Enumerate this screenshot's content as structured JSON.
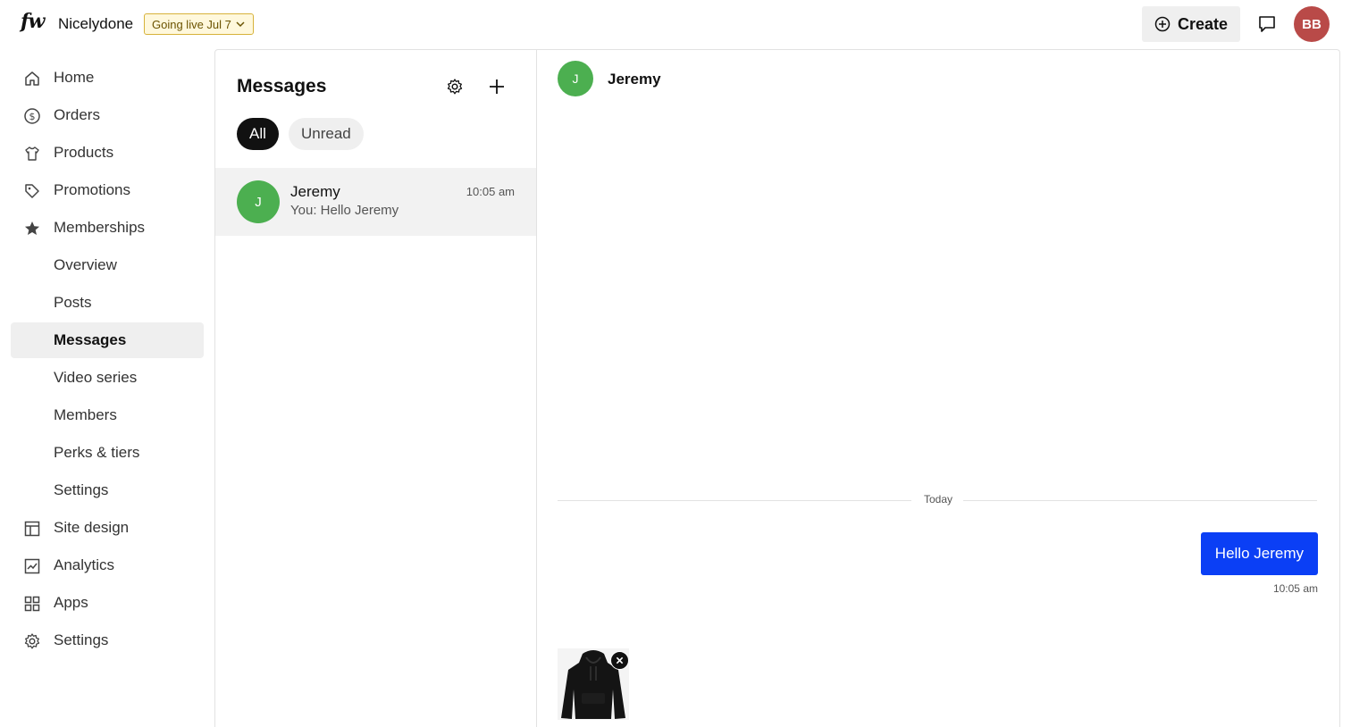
{
  "header": {
    "logo_text": "fw",
    "brand_name": "Nicelydone",
    "live_badge": "Going live Jul 7",
    "create_label": "Create",
    "user_initials": "BB"
  },
  "sidebar": {
    "items": [
      {
        "label": "Home",
        "icon": "home-icon"
      },
      {
        "label": "Orders",
        "icon": "dollar-circle-icon"
      },
      {
        "label": "Products",
        "icon": "shirt-icon"
      },
      {
        "label": "Promotions",
        "icon": "tag-icon"
      },
      {
        "label": "Memberships",
        "icon": "star-icon"
      },
      {
        "label": "Overview"
      },
      {
        "label": "Posts"
      },
      {
        "label": "Messages",
        "active": true
      },
      {
        "label": "Video series"
      },
      {
        "label": "Members"
      },
      {
        "label": "Perks & tiers"
      },
      {
        "label": "Settings"
      },
      {
        "label": "Site design",
        "icon": "layout-icon"
      },
      {
        "label": "Analytics",
        "icon": "chart-icon"
      },
      {
        "label": "Apps",
        "icon": "apps-grid-icon"
      },
      {
        "label": "Settings",
        "icon": "gear-icon"
      }
    ]
  },
  "messages_list": {
    "title": "Messages",
    "filters": {
      "all": "All",
      "unread": "Unread"
    },
    "conversations": [
      {
        "initial": "J",
        "name": "Jeremy",
        "preview": "You: Hello Jeremy",
        "time": "10:05 am"
      }
    ]
  },
  "chat": {
    "contact_initial": "J",
    "contact_name": "Jeremy",
    "date_divider": "Today",
    "messages": [
      {
        "text": "Hello Jeremy",
        "time": "10:05 am",
        "from_me": true
      }
    ],
    "attachment": {
      "kind": "product image",
      "icon": "hoodie-icon"
    }
  },
  "colors": {
    "accent_blue": "#0b3ff5",
    "avatar_green": "#4caf50",
    "user_avatar": "#b94a48",
    "badge_bg": "#fff8dc"
  }
}
